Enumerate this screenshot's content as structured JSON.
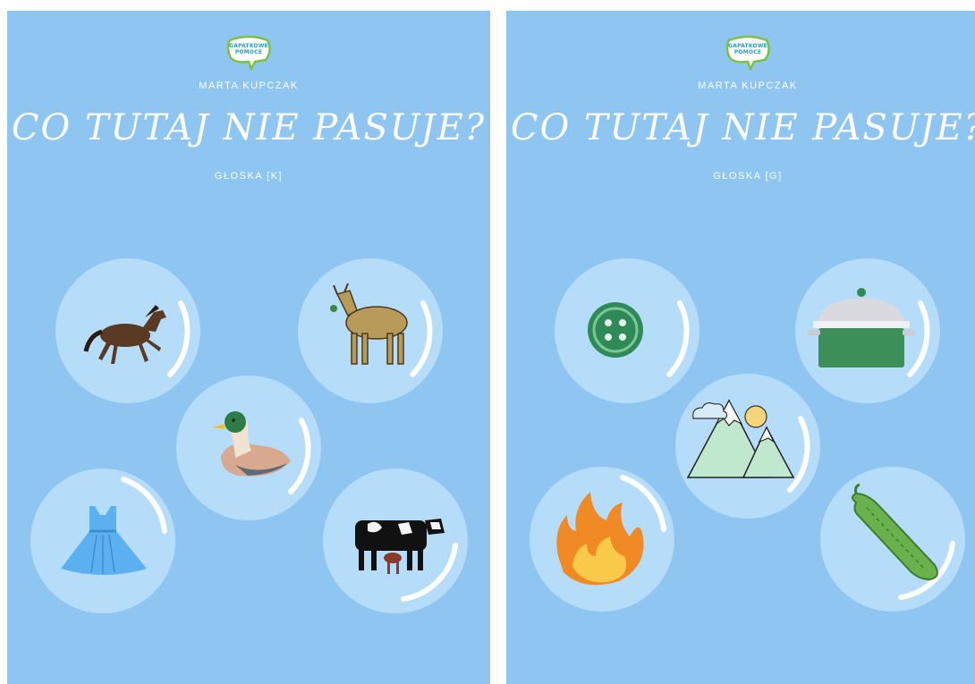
{
  "pages": [
    {
      "logo_text": [
        "GAPATKOWE",
        "POMOCE"
      ],
      "author": "MARTA KUPCZAK",
      "title": "CO TUTAJ NIE PASUJE?",
      "subtitle": "GŁOSKA [K]",
      "items": [
        {
          "icon": "horse-icon"
        },
        {
          "icon": "goat-icon"
        },
        {
          "icon": "duck-icon"
        },
        {
          "icon": "dress-icon"
        },
        {
          "icon": "cow-icon"
        }
      ]
    },
    {
      "logo_text": [
        "GAPATKOWE",
        "POMOCE"
      ],
      "author": "MARTA KUPCZAK",
      "title": "CO TUTAJ NIE PASUJE?",
      "subtitle": "GŁOSKA [G]",
      "items": [
        {
          "icon": "button-icon"
        },
        {
          "icon": "pot-icon"
        },
        {
          "icon": "mountains-icon"
        },
        {
          "icon": "fire-icon"
        },
        {
          "icon": "cucumber-icon"
        }
      ]
    }
  ],
  "colors": {
    "page_background": "#8ec6f1",
    "bubble": "#b5dcf8",
    "text": "#ffffff"
  }
}
